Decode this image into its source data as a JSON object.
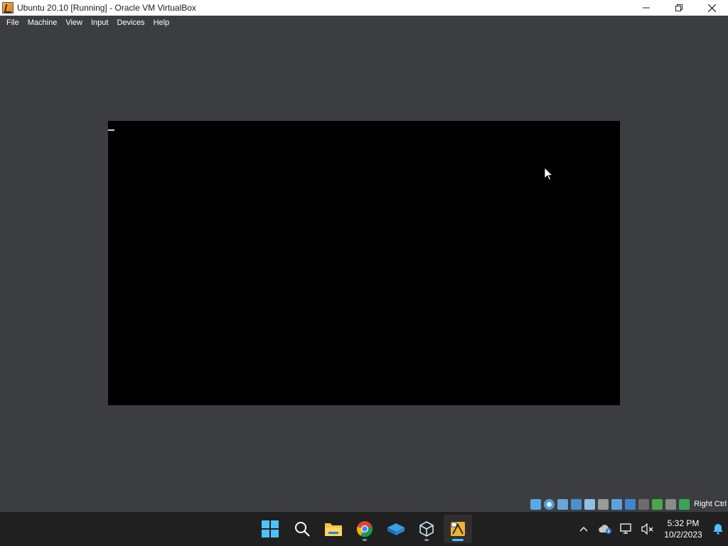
{
  "window": {
    "title": "Ubuntu 20.10 [Running] - Oracle VM VirtualBox"
  },
  "menu": {
    "items": [
      "File",
      "Machine",
      "View",
      "Input",
      "Devices",
      "Help"
    ]
  },
  "statusbar": {
    "icons": [
      "hard-disk-icon",
      "optical-drive-icon",
      "audio-icon",
      "network-icon",
      "usb-icon",
      "shared-folders-icon",
      "display-icon",
      "video-capture-icon",
      "recording-icon",
      "cpu-activity-icon",
      "mouse-integration-icon",
      "keyboard-capture-icon"
    ],
    "host_key": "Right Ctrl"
  },
  "taskbar": {
    "apps": [
      "start-button",
      "search-button",
      "file-explorer-app",
      "chrome-app",
      "remote-app",
      "virtualbox-manager-app",
      "virtualbox-vm-app"
    ]
  },
  "tray": {
    "time": "5:32 PM",
    "date": "10/2/2023"
  },
  "colors": {
    "vm_background": "#3c3d40",
    "vm_screen": "#000000",
    "taskbar": "#202020",
    "accent": "#4cc2ff"
  }
}
